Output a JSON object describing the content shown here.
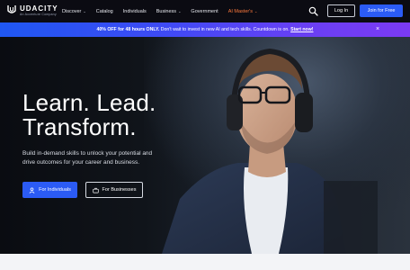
{
  "brand": {
    "name": "UDACITY",
    "tagline": "An Accenture Company"
  },
  "nav": {
    "items": [
      {
        "label": "Discover",
        "dropdown": true,
        "accent": false
      },
      {
        "label": "Catalog",
        "dropdown": false,
        "accent": false
      },
      {
        "label": "Individuals",
        "dropdown": false,
        "accent": false
      },
      {
        "label": "Business",
        "dropdown": true,
        "accent": false
      },
      {
        "label": "Government",
        "dropdown": false,
        "accent": false
      },
      {
        "label": "AI Master's",
        "dropdown": true,
        "accent": true
      }
    ],
    "search_icon": "search-icon",
    "login_label": "Log In",
    "join_label": "Join for Free"
  },
  "promo": {
    "highlight": "40% OFF for 48 hours ONLY.",
    "message": " Don't wait to invest in new AI and tech skills. Countdown is on. ",
    "link": "Start now!",
    "close_icon": "close-icon"
  },
  "hero": {
    "title_line1": "Learn. Lead.",
    "title_line2": "Transform.",
    "subtitle": "Build in-demand skills to unlock your potential and drive outcomes for your career and business.",
    "individuals_label": "For Individuals",
    "businesses_label": "For Businesses",
    "individuals_icon": "person-icon",
    "businesses_icon": "briefcase-icon"
  },
  "colors": {
    "nav_bg": "#0b0b12",
    "accent_blue": "#2b5bf5",
    "ai_masters_orange": "#ff7a3d",
    "promo_gradient_start": "#1f57f2",
    "promo_gradient_end": "#7b3af4"
  }
}
